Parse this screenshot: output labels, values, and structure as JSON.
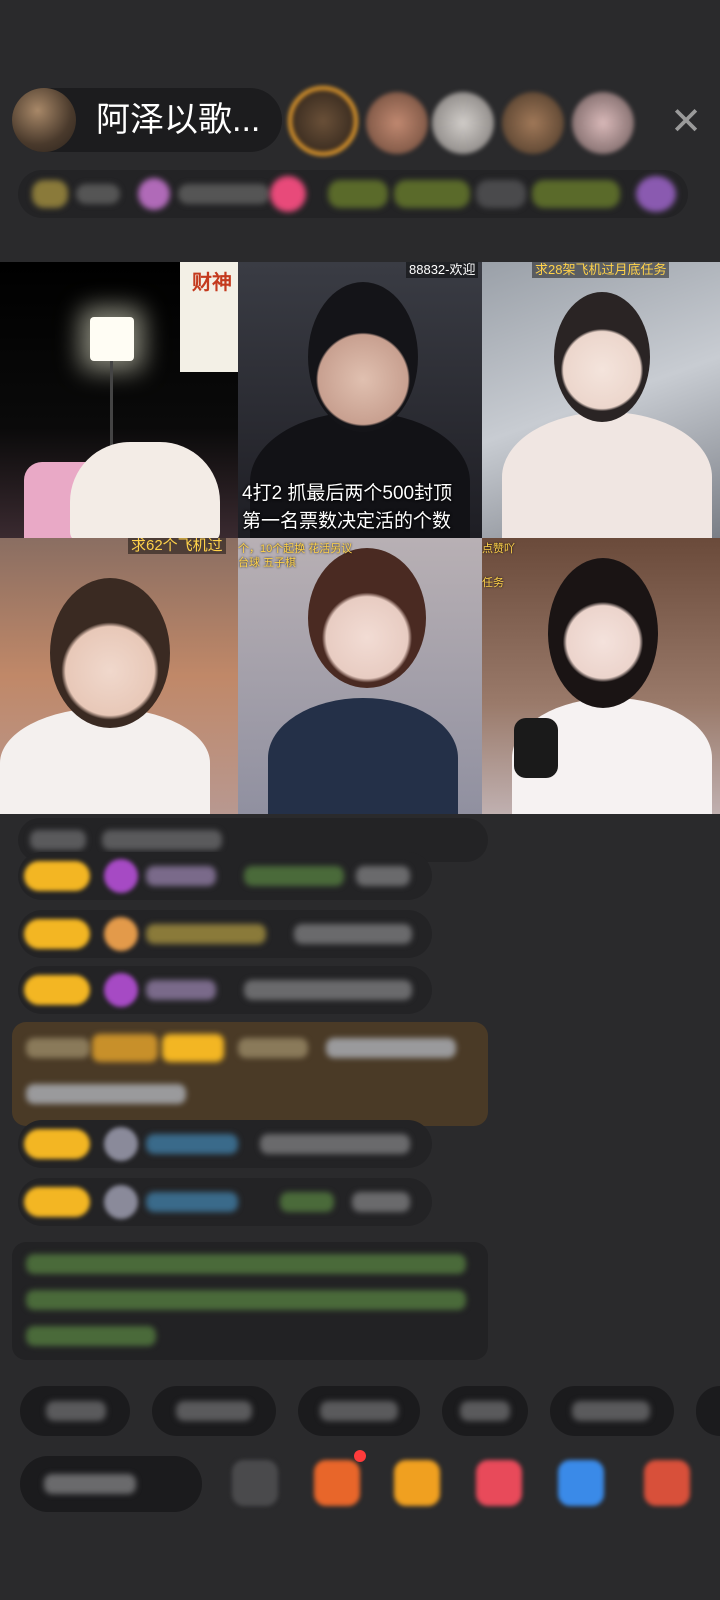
{
  "header": {
    "host_name": "阿泽以歌...",
    "close_icon": "close-icon",
    "top_viewer_accent": "#e39a2b"
  },
  "grid": {
    "tile1": {
      "poster_label": "财神"
    },
    "tile2": {
      "top_text": "88832-欢迎",
      "caption_line1": "4打2  抓最后两个500封顶",
      "caption_line2": "第一名票数决定活的个数"
    },
    "tile3": {
      "top_text": "求28架飞机过月底任务"
    },
    "tile4": {
      "top_text": "求62个飞机过"
    },
    "tile5": {
      "top_text": "个，10个起换   花活另议",
      "sub_text": "台球   五子棋"
    },
    "tile6": {
      "top_text": "点赞吖",
      "sub_text": "任务"
    }
  },
  "colors": {
    "background": "#2a2a2c",
    "badge": "#f3b623",
    "gift_box": "#4a3a26"
  }
}
